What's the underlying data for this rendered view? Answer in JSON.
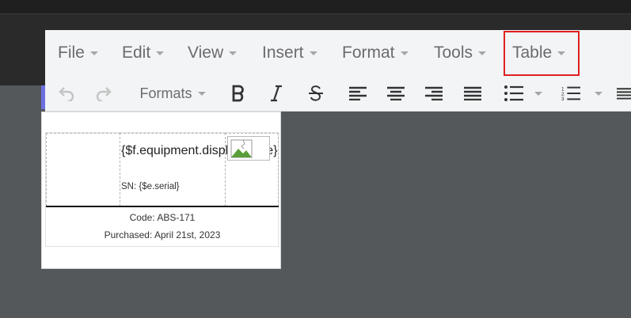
{
  "menubar": {
    "items": [
      {
        "label": "File"
      },
      {
        "label": "Edit"
      },
      {
        "label": "View"
      },
      {
        "label": "Insert"
      },
      {
        "label": "Format"
      },
      {
        "label": "Tools"
      },
      {
        "label": "Table"
      }
    ],
    "highlighted": "Table"
  },
  "toolbar": {
    "formats_label": "Formats",
    "buttons": [
      "undo-icon",
      "redo-icon",
      "bold-icon",
      "italic-icon",
      "strikethrough-icon",
      "align-left-icon",
      "align-center-icon",
      "align-right-icon",
      "align-justify-icon",
      "bullet-list-icon",
      "numbered-list-icon"
    ]
  },
  "document": {
    "equipment_field": "{$f.equipment.displayname}",
    "serial": "SN: {$e.serial}",
    "code": "Code: ABS-171",
    "purchased": "Purchased: April 21st, 2023"
  },
  "colors": {
    "highlight_border": "#e02020",
    "accent": "#6c6fe0"
  }
}
